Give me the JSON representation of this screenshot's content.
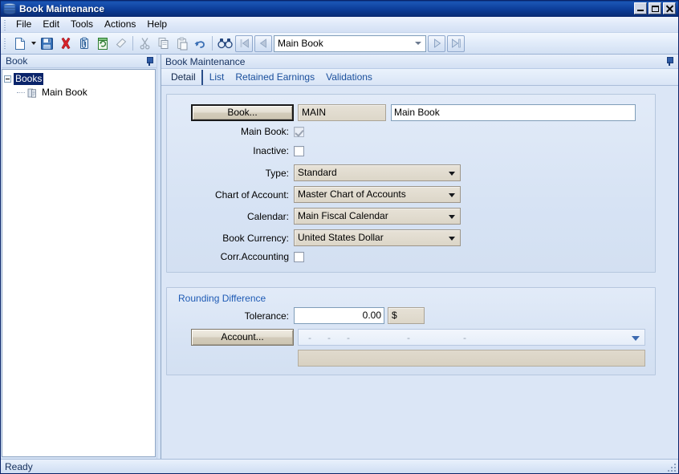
{
  "window": {
    "title": "Book Maintenance",
    "icon": "book-stack-icon",
    "minimize_label": "Minimize",
    "maximize_label": "Maximize",
    "close_label": "Close"
  },
  "menubar": {
    "items": [
      {
        "label": "File"
      },
      {
        "label": "Edit"
      },
      {
        "label": "Tools"
      },
      {
        "label": "Actions"
      },
      {
        "label": "Help"
      }
    ]
  },
  "toolbar": {
    "buttons": [
      {
        "name": "new-icon",
        "label": "New"
      },
      {
        "name": "new-dropdown-icon",
        "label": "New options"
      },
      {
        "name": "save-icon",
        "label": "Save"
      },
      {
        "name": "delete-icon",
        "label": "Delete"
      },
      {
        "name": "attach-icon",
        "label": "Attach"
      },
      {
        "name": "refresh-icon",
        "label": "Refresh"
      },
      {
        "name": "erase-icon",
        "label": "Clear"
      },
      {
        "name": "cut-icon",
        "label": "Cut"
      },
      {
        "name": "copy-icon",
        "label": "Copy"
      },
      {
        "name": "paste-icon",
        "label": "Paste"
      },
      {
        "name": "undo-icon",
        "label": "Undo"
      },
      {
        "name": "find-icon",
        "label": "Find"
      }
    ],
    "nav": {
      "first_label": "First",
      "prev_label": "Previous",
      "next_label": "Next",
      "last_label": "Last",
      "record_value": "Main Book",
      "record_placeholder": ""
    }
  },
  "sidebar": {
    "caption": "Book",
    "pin_label": "Auto Hide",
    "tree": {
      "root": {
        "label": "Books",
        "selected": true
      },
      "children": [
        {
          "label": "Main Book",
          "icon": "book-icon"
        }
      ]
    }
  },
  "main": {
    "caption": "Book Maintenance",
    "pin_label": "Auto Hide",
    "tabs": [
      {
        "label": "Detail",
        "active": true
      },
      {
        "label": "List",
        "active": false
      },
      {
        "label": "Retained Earnings",
        "active": false
      },
      {
        "label": "Validations",
        "active": false
      }
    ],
    "detail": {
      "book_button": "Book...",
      "book_code": "MAIN",
      "book_name": "Main Book",
      "main_book": {
        "label": "Main Book:",
        "checked": true,
        "disabled": true
      },
      "inactive": {
        "label": "Inactive:",
        "checked": false,
        "disabled": false
      },
      "type": {
        "label": "Type:",
        "value": "Standard"
      },
      "chart_of_account": {
        "label": "Chart of Account:",
        "value": "Master Chart of Accounts"
      },
      "calendar": {
        "label": "Calendar:",
        "value": "Main Fiscal Calendar"
      },
      "book_currency": {
        "label": "Book Currency:",
        "value": "United States Dollar"
      },
      "corr_accounting": {
        "label": "Corr.Accounting",
        "checked": false
      }
    },
    "rounding": {
      "title": "Rounding Difference",
      "tolerance_label": "Tolerance:",
      "tolerance_value": "0.00",
      "currency_symbol": "$",
      "account_button": "Account...",
      "account_segments": [
        "-",
        "-",
        "-",
        "-",
        "-"
      ],
      "account_description": ""
    }
  },
  "statusbar": {
    "message": "Ready"
  },
  "colors": {
    "title_bar": "#0d3f9b",
    "selection": "#0a246a",
    "panel_bg": "#dbe6f6",
    "group_title": "#1f5bb5",
    "accent_link": "#1a4f9c"
  }
}
